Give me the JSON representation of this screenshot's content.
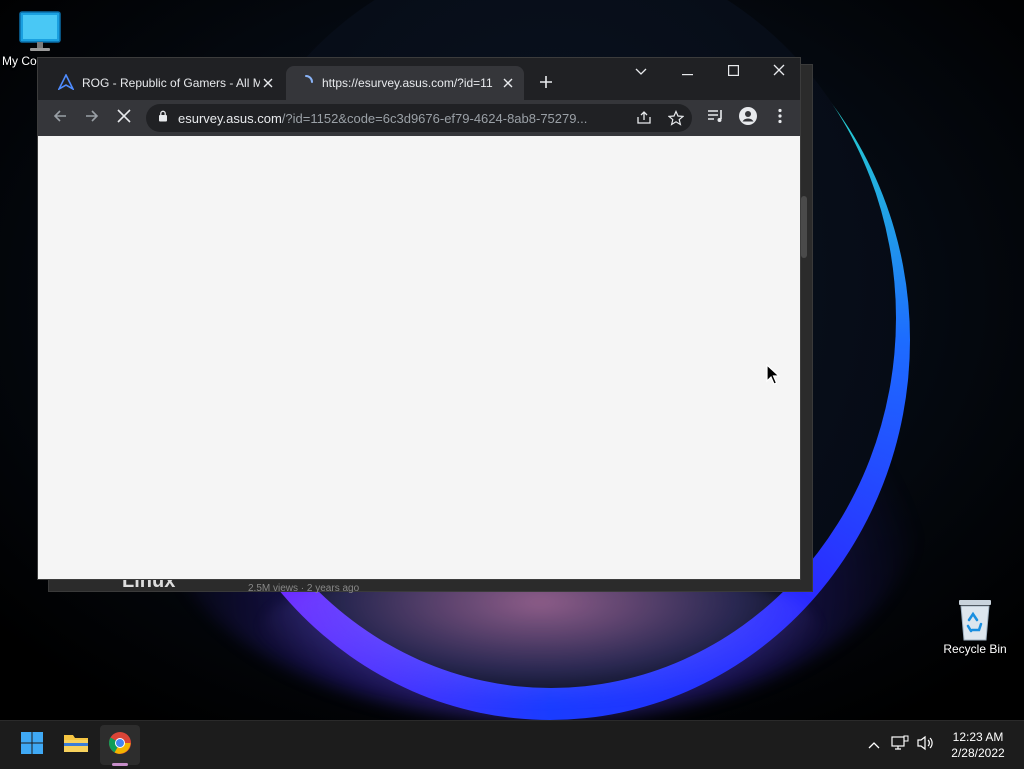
{
  "desktop": {
    "icons": [
      {
        "label": "My Co",
        "icon": "monitor-icon"
      },
      {
        "label": "Recycle Bin",
        "icon": "recycle-bin-icon"
      }
    ],
    "background_window_text": "Linux",
    "background_window_subtext": "2.5M views · 2 years ago"
  },
  "browser": {
    "tabs": [
      {
        "title": "ROG - Republic of Gamers - All M",
        "icon": "rog-icon",
        "active": false
      },
      {
        "title": "https://esurvey.asus.com/?id=11",
        "icon": "loading-spinner-icon",
        "active": true
      }
    ],
    "address_bar": {
      "domain": "esurvey.asus.com",
      "path": "/?id=1152&code=6c3d9676-ef79-4624-8ab8-75279..."
    },
    "loading": true,
    "colors": {
      "frame": "#202124",
      "toolbar": "#35363a",
      "content": "#f5f5f5"
    }
  },
  "taskbar": {
    "apps": [
      {
        "name": "start",
        "icon": "windows-start-icon"
      },
      {
        "name": "file-explorer",
        "icon": "folder-icon"
      },
      {
        "name": "chrome",
        "icon": "chrome-icon",
        "active": true
      }
    ],
    "clock": {
      "time": "12:23 AM",
      "date": "2/28/2022"
    }
  }
}
